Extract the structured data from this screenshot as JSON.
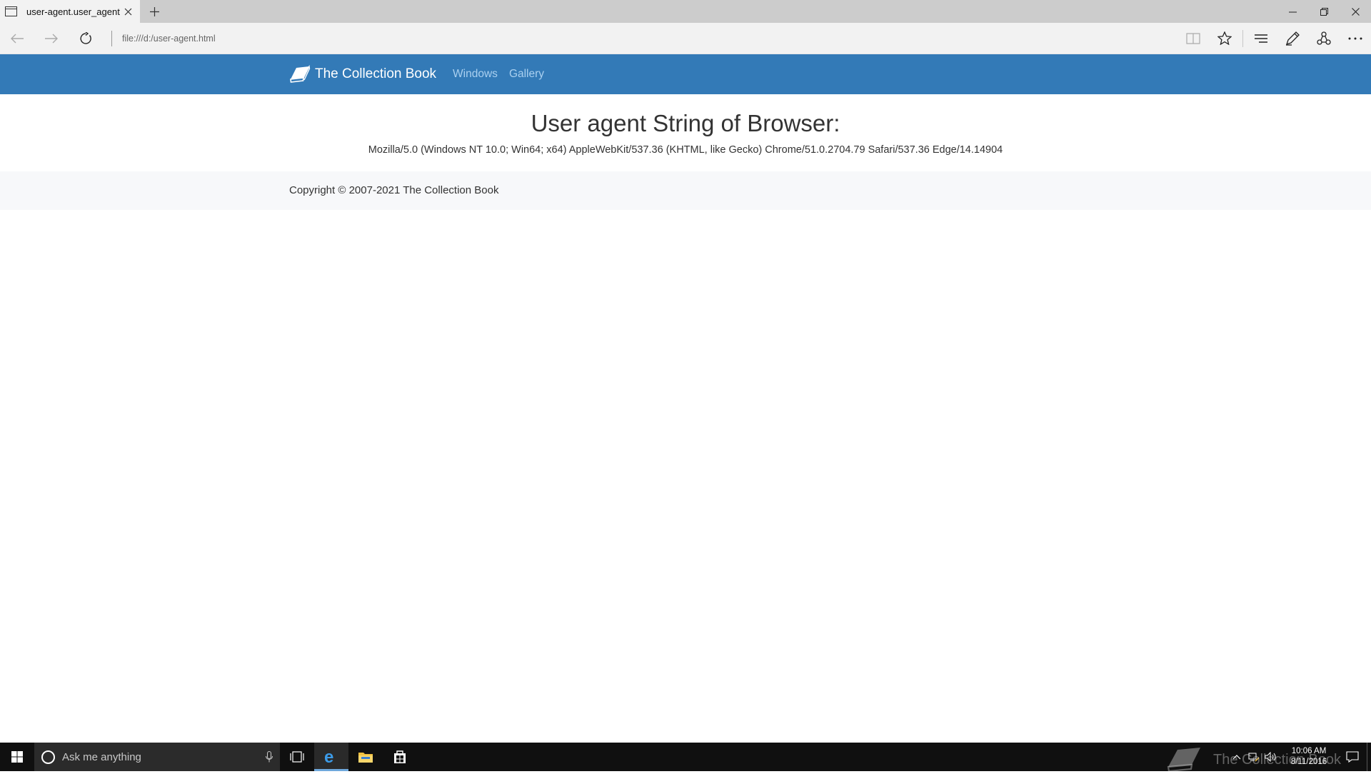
{
  "browser": {
    "tab_title": "user-agent.user_agent -",
    "address": "file:///d:/user-agent.html"
  },
  "site": {
    "brand": "The Collection Book",
    "nav_links": [
      "Windows",
      "Gallery"
    ],
    "heading": "User agent String of Browser:",
    "user_agent": "Mozilla/5.0 (Windows NT 10.0; Win64; x64) AppleWebKit/537.36 (KHTML, like Gecko) Chrome/51.0.2704.79 Safari/537.36 Edge/14.14904",
    "copyright": "Copyright © 2007-2021 The Collection Book",
    "colors": {
      "navbar": "#337ab7",
      "nav_link": "#aad0f0",
      "footer": "#f7f8fa"
    }
  },
  "taskbar": {
    "search_placeholder": "Ask me anything",
    "watermark": "The Collection Book",
    "time": "10:06 AM",
    "date": "8/11/2016",
    "apps": [
      "task-view",
      "edge",
      "file-explorer",
      "store"
    ],
    "active_app": "edge"
  }
}
